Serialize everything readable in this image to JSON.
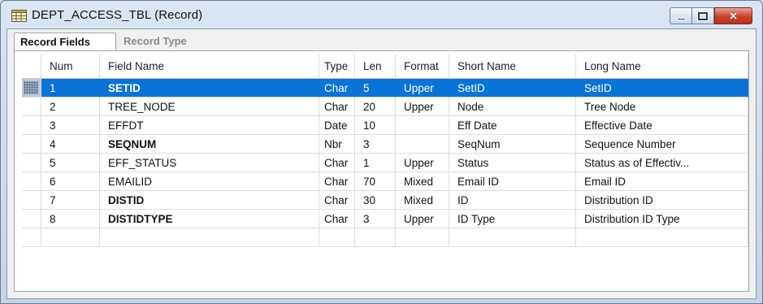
{
  "window": {
    "title": "DEPT_ACCESS_TBL (Record)",
    "icon": "record-table-icon",
    "controls": {
      "minimize": "minimize-icon",
      "maximize": "maximize-icon",
      "close": "×"
    }
  },
  "tabs": [
    {
      "label": "Record Fields",
      "active": true
    },
    {
      "label": "Record Type",
      "active": false
    }
  ],
  "table": {
    "columns": [
      "Num",
      "Field Name",
      "Type",
      "Len",
      "Format",
      "Short Name",
      "Long Name"
    ],
    "rows": [
      {
        "num": "1",
        "field": "SETID",
        "type": "Char",
        "len": "5",
        "format": "Upper",
        "short": "SetID",
        "long": "SetID",
        "bold": true,
        "selected": true
      },
      {
        "num": "2",
        "field": "TREE_NODE",
        "type": "Char",
        "len": "20",
        "format": "Upper",
        "short": "Node",
        "long": "Tree Node",
        "bold": false,
        "selected": false
      },
      {
        "num": "3",
        "field": "EFFDT",
        "type": "Date",
        "len": "10",
        "format": "",
        "short": "Eff Date",
        "long": "Effective Date",
        "bold": false,
        "selected": false
      },
      {
        "num": "4",
        "field": "SEQNUM",
        "type": "Nbr",
        "len": "3",
        "format": "",
        "short": "SeqNum",
        "long": "Sequence Number",
        "bold": true,
        "selected": false
      },
      {
        "num": "5",
        "field": "EFF_STATUS",
        "type": "Char",
        "len": "1",
        "format": "Upper",
        "short": "Status",
        "long": "Status as of Effectiv...",
        "bold": false,
        "selected": false
      },
      {
        "num": "6",
        "field": "EMAILID",
        "type": "Char",
        "len": "70",
        "format": "Mixed",
        "short": "Email ID",
        "long": "Email ID",
        "bold": false,
        "selected": false
      },
      {
        "num": "7",
        "field": "DISTID",
        "type": "Char",
        "len": "30",
        "format": "Mixed",
        "short": "ID",
        "long": "Distribution ID",
        "bold": true,
        "selected": false
      },
      {
        "num": "8",
        "field": "DISTIDTYPE",
        "type": "Char",
        "len": "3",
        "format": "Upper",
        "short": "ID Type",
        "long": "Distribution ID Type",
        "bold": true,
        "selected": false
      }
    ]
  },
  "colors": {
    "selection": "#0a73d8",
    "close_button": "#c8412b"
  }
}
